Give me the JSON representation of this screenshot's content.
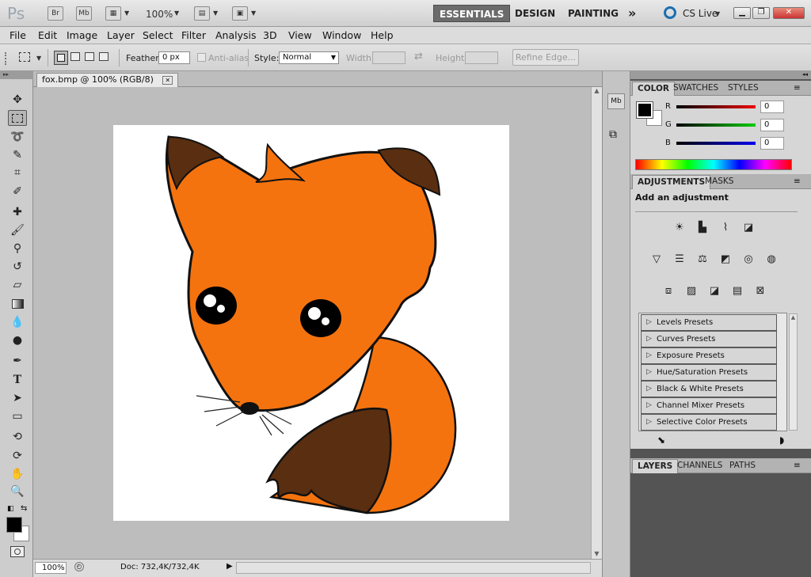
{
  "appbar": {
    "logo": "Ps",
    "bridge": "Br",
    "minibridge": "Mb",
    "zoom": "100%",
    "workspaces": [
      "ESSENTIALS",
      "DESIGN",
      "PAINTING"
    ],
    "more": "»",
    "cslive": "CS Live"
  },
  "menu": [
    "File",
    "Edit",
    "Image",
    "Layer",
    "Select",
    "Filter",
    "Analysis",
    "3D",
    "View",
    "Window",
    "Help"
  ],
  "options": {
    "feather_label": "Feather:",
    "feather_value": "0 px",
    "antialias": "Anti-alias",
    "style_label": "Style:",
    "style_value": "Normal",
    "width_label": "Width:",
    "height_label": "Height:",
    "refine": "Refine Edge..."
  },
  "document": {
    "tab_title": "fox.bmp @ 100% (RGB/8)"
  },
  "status": {
    "zoom": "100%",
    "doc": "Doc: 732,4K/732,4K"
  },
  "color_panel": {
    "tabs": [
      "COLOR",
      "SWATCHES",
      "STYLES"
    ],
    "r_label": "R",
    "g_label": "G",
    "b_label": "B",
    "r": "0",
    "g": "0",
    "b": "0"
  },
  "adjustments": {
    "tabs": [
      "ADJUSTMENTS",
      "MASKS"
    ],
    "heading": "Add an adjustment",
    "presets": [
      "Levels Presets",
      "Curves Presets",
      "Exposure Presets",
      "Hue/Saturation Presets",
      "Black & White Presets",
      "Channel Mixer Presets",
      "Selective Color Presets"
    ]
  },
  "layers": {
    "tabs": [
      "LAYERS",
      "CHANNELS",
      "PATHS"
    ]
  },
  "colors": {
    "fox_orange": "#f4730f",
    "fox_brown": "#5a2e10",
    "canvas_bg": "#bdbdbd"
  }
}
